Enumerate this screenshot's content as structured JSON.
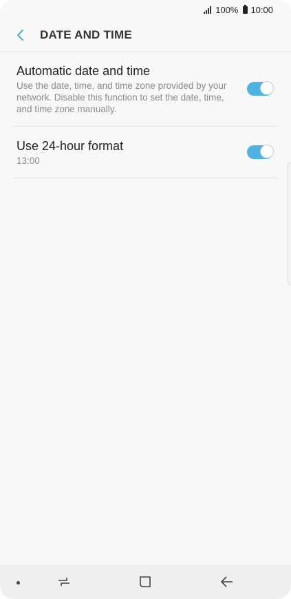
{
  "status_bar": {
    "battery": "100%",
    "time": "10:00",
    "icons": [
      "signal-icon",
      "battery-icon"
    ]
  },
  "app_bar": {
    "title": "DATE AND TIME",
    "back_icon": "chevron-left-icon"
  },
  "settings": [
    {
      "title": "Automatic date and time",
      "summary": "Use the date, time, and time zone provided by your network. Disable this function to set the date, time, and time zone manually.",
      "enabled": true
    },
    {
      "title": "Use 24-hour format",
      "summary": "13:00",
      "enabled": true
    }
  ],
  "nav_bar": {
    "icons": [
      "dot-icon",
      "recent-apps-icon",
      "home-icon",
      "back-arrow-icon"
    ]
  },
  "colors": {
    "accent": "#4fb3e2",
    "background": "#f8f8f8",
    "nav_background": "#efefef"
  }
}
